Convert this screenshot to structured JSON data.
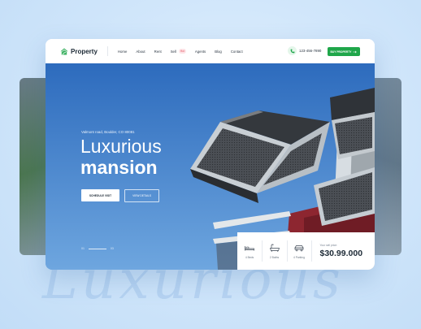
{
  "background": {
    "watermark_text": "Luxurious"
  },
  "navbar": {
    "logo_text": "Property",
    "logo_icon": "house-leaf-icon",
    "menu": [
      {
        "label": "Home"
      },
      {
        "label": "About"
      },
      {
        "label": "Rent"
      },
      {
        "label": "Sell",
        "badge": "Hot"
      },
      {
        "label": "Agents"
      },
      {
        "label": "Blog"
      },
      {
        "label": "Contact"
      }
    ],
    "phone_icon": "phone-icon",
    "phone": "123-456-7890",
    "cta_label": "BUY PROPERTY",
    "cta_icon": "arrow-right-icon",
    "accent_color": "#1fa64a"
  },
  "hero": {
    "address": "Valmont road, Boulder, CO 80081",
    "title_line1": "Luxurious",
    "title_line2": "mansion",
    "primary_button": "SCHEDULE VISIT",
    "secondary_button": "VIEW DETAILS",
    "slide_current": "01",
    "slide_total": "03"
  },
  "stats": {
    "features": [
      {
        "label": "4 Beds",
        "icon": "bed-icon"
      },
      {
        "label": "2 Baths",
        "icon": "bath-icon"
      },
      {
        "label": "4 Parking",
        "icon": "car-icon"
      }
    ],
    "price_label": "Your sell price:",
    "price": "$30.99.000"
  }
}
